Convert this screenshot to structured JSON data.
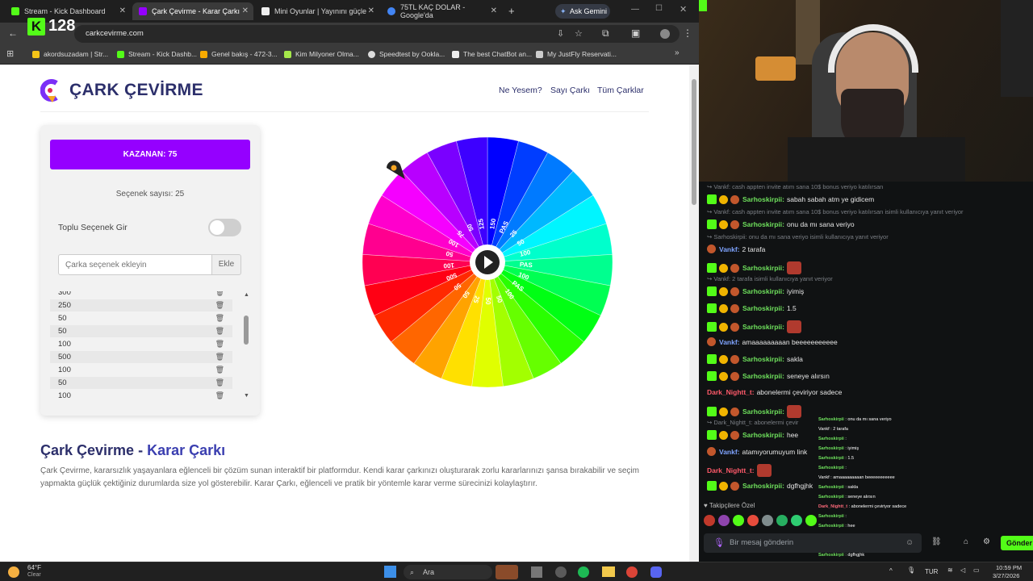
{
  "browser": {
    "tabs": [
      {
        "label": "Stream - Kick Dashboard",
        "color": "#53fc18"
      },
      {
        "label": "Çark Çevirme - Karar Çarkı",
        "color": "#9500ff"
      },
      {
        "label": "Mini Oyunlar | Yayınını güçle",
        "color": "#ffffff"
      },
      {
        "label": "75TL KAÇ DOLAR - Google'da",
        "color": "#4285f4"
      }
    ],
    "new_tab": "+",
    "gemini_label": "Ask Gemini",
    "url": "carkcevirme.com",
    "bookmarks": [
      "akordsuzadam | Str...",
      "Stream - Kick Dashb...",
      "Genel bakış - 472-3...",
      "Kim Milyoner Olma...",
      "Speedtest by Ookla...",
      "The best ChatBot an...",
      "My JustFly Reservati..."
    ]
  },
  "kick_overlay": {
    "viewers": "128"
  },
  "site": {
    "logo": "ÇARK ÇEVİRME",
    "nav": [
      "Ne Yesem?",
      "Sayı Çarkı",
      "Tüm Çarklar"
    ],
    "winner": "KAZANAN: 75",
    "option_count": "Seçenek sayısı: 25",
    "bulk_label": "Toplu Seçenek Gir",
    "input_placeholder": "Çarka seçenek ekleyin",
    "add_label": "Ekle",
    "options": [
      "300",
      "250",
      "50",
      "50",
      "100",
      "500",
      "100",
      "50",
      "100"
    ],
    "title_part1": "Çark Çevirme - ",
    "title_part2": "Karar Çarkı",
    "description": "Çark Çevirme, kararsızlık yaşayanlara eğlenceli bir çözüm sunan interaktif bir platformdur. Kendi karar çarkınızı oluşturarak zorlu kararlarınızı şansa bırakabilir ve seçim yapmakta güçlük çektiğiniz durumlarda size yol gösterebilir. Karar Çarkı, eğlenceli ve pratik bir yöntemle karar verme sürecinizi kolaylaştırır.",
    "wheel_labels": [
      "150",
      "PAS",
      "25",
      "50",
      "100",
      "PAS",
      "100",
      "PAS",
      "100",
      "50",
      "50",
      "25",
      "50",
      "50",
      "500",
      "100",
      "50",
      "100",
      "75",
      "50",
      "125"
    ]
  },
  "chat": {
    "messages": [
      {
        "type": "reply",
        "text": "Vankf: cash appten invite atım sana 10$ bonus veriyo katılırsan"
      },
      {
        "type": "msg",
        "user": "Sarhoskirpii",
        "color": "g",
        "text": "sabah sabah atm ye gidicem"
      },
      {
        "type": "reply",
        "text": "Vankf: cash appten invite atım sana 10$ bonus veriyo katılırsan isimli kullanıcıya yanıt veriyor"
      },
      {
        "type": "msg",
        "user": "Sarhoskirpii",
        "color": "g",
        "text": "onu da mı sana veriyo"
      },
      {
        "type": "reply",
        "text": "Sarhoskirpii: onu da mı sana veriyo isimli kullanıcıya yanıt veriyor"
      },
      {
        "type": "msg",
        "user": "Vankf",
        "color": "b",
        "text": "2 tarafa"
      },
      {
        "type": "msg",
        "user": "Sarhoskirpii",
        "color": "g",
        "text": ""
      },
      {
        "type": "reply",
        "text": "Vankf: 2 tarafa isimli kullanıcıya yanıt veriyor"
      },
      {
        "type": "msg",
        "user": "Sarhoskirpii",
        "color": "g",
        "text": "iyimiş"
      },
      {
        "type": "msg",
        "user": "Sarhoskirpii",
        "color": "g",
        "text": "1.5"
      },
      {
        "type": "msg",
        "user": "Sarhoskirpii",
        "color": "g",
        "text": ""
      },
      {
        "type": "msg",
        "user": "Vankf",
        "color": "b",
        "text": "amaaaaaaaaan beeeeeeeeeee"
      },
      {
        "type": "msg",
        "user": "Sarhoskirpii",
        "color": "g",
        "text": "sakla"
      },
      {
        "type": "msg",
        "user": "Sarhoskirpii",
        "color": "g",
        "text": "seneye alırsın"
      },
      {
        "type": "msg",
        "user": "Dark_Nightt_t",
        "color": "r",
        "text": "abonelermi çeviriyor sadece"
      },
      {
        "type": "msg",
        "user": "Sarhoskirpii",
        "color": "g",
        "text": ""
      },
      {
        "type": "reply",
        "text": "Dark_Nightt_t: abonelermi çevir"
      },
      {
        "type": "msg",
        "user": "Sarhoskirpii",
        "color": "g",
        "text": "hee"
      },
      {
        "type": "msg",
        "user": "Vankf",
        "color": "b",
        "text": "atamıyorumuyum link"
      },
      {
        "type": "msg",
        "user": "Dark_Nightt_t",
        "color": "r",
        "text": ""
      },
      {
        "type": "msg",
        "user": "Sarhoskirpii",
        "color": "g",
        "text": "dgfhgjhk"
      }
    ],
    "followers_label": "Takipçilere Özel",
    "input_placeholder": "Bir mesaj gönderin",
    "send_label": "Gönder"
  },
  "overlay_chat": [
    {
      "user": "Sarhoskirpii",
      "text": "onu da mı sana veriyo",
      "c": "g"
    },
    {
      "user": "Vankf",
      "text": "2 tarafa",
      "c": "w"
    },
    {
      "user": "Sarhoskirpii",
      "text": "",
      "c": "g"
    },
    {
      "user": "Sarhoskirpii",
      "text": "iyimiş",
      "c": "g"
    },
    {
      "user": "Sarhoskirpii",
      "text": "1.5",
      "c": "g"
    },
    {
      "user": "Sarhoskirpii",
      "text": "",
      "c": "g"
    },
    {
      "user": "Vankf",
      "text": "amaaaaaaaaan beeeeeeeeeee",
      "c": "w"
    },
    {
      "user": "Sarhoskirpii",
      "text": "sakla",
      "c": "g"
    },
    {
      "user": "Sarhoskirpii",
      "text": "seneye alırsın",
      "c": "g"
    },
    {
      "user": "Dark_Nightt_t",
      "text": "abonelermi çeviriyor sadece",
      "c": "r"
    },
    {
      "user": "Sarhoskirpii",
      "text": "",
      "c": "g"
    },
    {
      "user": "Sarhoskirpii",
      "text": "hee",
      "c": "g"
    },
    {
      "user": "Vankf",
      "text": "atamıyorumuyum link",
      "c": "w"
    },
    {
      "user": "Dark_Nightt_t",
      "text": "",
      "c": "r"
    },
    {
      "user": "Sarhoskirpii",
      "text": "dgfhgjhk",
      "c": "g"
    }
  ],
  "taskbar": {
    "weather_temp": "64°F",
    "weather_desc": "Clear",
    "search": "Ara",
    "lang": "TUR",
    "time": "10:59 PM",
    "date": "3/27/2026"
  }
}
